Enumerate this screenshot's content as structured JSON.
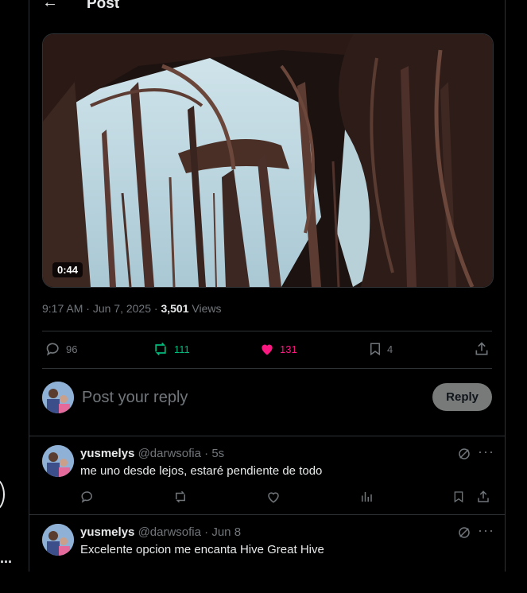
{
  "header": {
    "back_icon": "arrow-left-icon",
    "title": "Post"
  },
  "media": {
    "duration": "0:44"
  },
  "post_meta": {
    "time": "9:17 AM",
    "sep1": " · ",
    "date": "Jun 7, 2025",
    "sep2": " · ",
    "views_count": "3,501",
    "views_label": " Views"
  },
  "stats": {
    "replies": "96",
    "reposts": "111",
    "likes": "131",
    "bookmarks": "4",
    "colors": {
      "repost": "#00ba7c",
      "like": "#f91880",
      "muted": "#71767b"
    }
  },
  "reply_box": {
    "placeholder": "Post your reply",
    "button_label": "Reply"
  },
  "replies": [
    {
      "name": "yusmelys",
      "handle": "@darwsofia",
      "dot": " · ",
      "time": "5s",
      "text": "me uno desde lejos, estaré pendiente de todo"
    },
    {
      "name": "yusmelys",
      "handle": "@darwsofia",
      "dot": " · ",
      "time": "Jun 8",
      "text": "Excelente opcion me encanta Hive Great Hive"
    }
  ],
  "left_rail": {
    "more_label": "..."
  }
}
